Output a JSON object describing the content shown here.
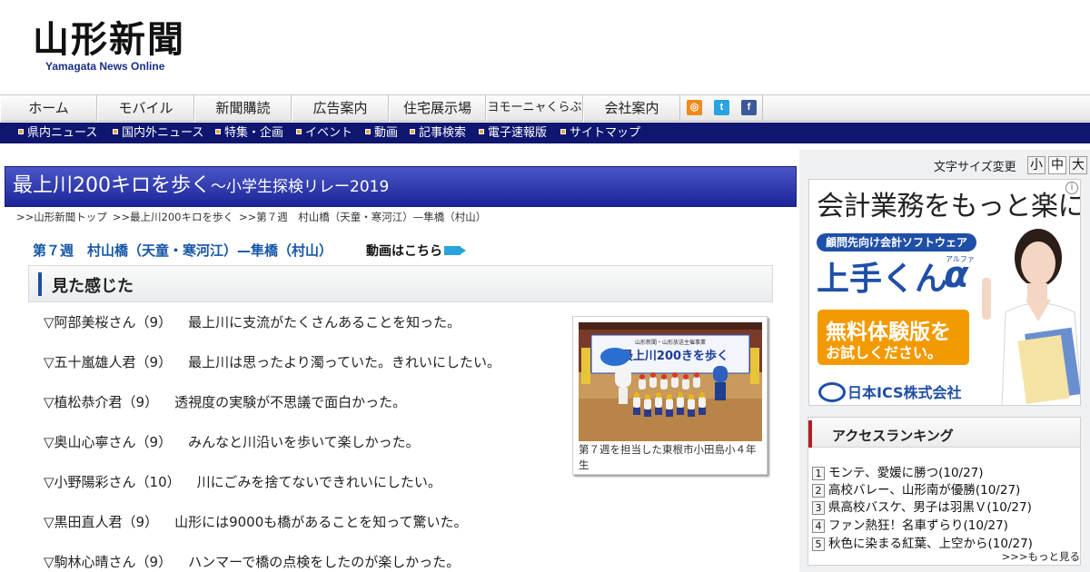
{
  "header": {
    "logo_text": "山形新聞",
    "logo_sub": "Yamagata News Online"
  },
  "main_nav": [
    "ホーム",
    "モバイル",
    "新聞購読",
    "広告案内",
    "住宅展示場",
    "ヨモーニャくらぶ",
    "会社案内"
  ],
  "social": [
    {
      "name": "rss-icon",
      "glyph": "◎",
      "color": "#f08a1c"
    },
    {
      "name": "twitter-icon",
      "glyph": "t",
      "color": "#2aa3e0"
    },
    {
      "name": "facebook-icon",
      "glyph": "f",
      "color": "#3b5998"
    }
  ],
  "sub_nav": [
    "県内ニュース",
    "国内外ニュース",
    "特集・企画",
    "イベント",
    "動画",
    "記事検索",
    "電子速報版",
    "サイトマップ"
  ],
  "banner": {
    "title": "最上川200キロを歩く",
    "subtitle": "～小学生探検リレー2019"
  },
  "breadcrumb": [
    ">>山形新聞トップ",
    ">>最上川200キロを歩く",
    ">>第７週　村山橋（天童・寒河江）—隼橋（村山）"
  ],
  "week_title": "第７週　村山橋（天童・寒河江）—隼橋（村山）",
  "video_link": "動画はこちら",
  "section_heading": "見た感じた",
  "quotes": [
    {
      "name": "▽阿部美桜さん（9）",
      "text": "最上川に支流がたくさんあることを知った。"
    },
    {
      "name": "▽五十嵐雄人君（9）",
      "text": "最上川は思ったより濁っていた。きれいにしたい。"
    },
    {
      "name": "▽植松恭介君（9）",
      "text": "透視度の実験が不思議で面白かった。"
    },
    {
      "name": "▽奥山心寧さん（9）",
      "text": "みんなと川沿いを歩いて楽しかった。"
    },
    {
      "name": "▽小野陽彩さん（10）",
      "text": "川にごみを捨てないできれいにしたい。"
    },
    {
      "name": "▽黒田直人君（9）",
      "text": "山形には9000も橋があることを知って驚いた。"
    },
    {
      "name": "▽駒林心晴さん（9）",
      "text": "ハンマーで橋の点検をしたのが楽しかった。"
    }
  ],
  "photo": {
    "banner_text": "最上川200きを歩く",
    "banner_small": "山形新聞・山形放送主催事業",
    "caption": "第７週を担当した東根市小田島小４年生"
  },
  "font_size": {
    "label": "文字サイズ変更",
    "options": [
      "小",
      "中",
      "大"
    ],
    "selected": "中"
  },
  "ad": {
    "headline": "会計業務をもっと楽に。",
    "tag": "顧問先向け会計ソフトウェア",
    "product": "上手くん",
    "product_alpha": "α",
    "product_ruby": "アルファ",
    "trial_line1": "無料体験版を",
    "trial_line2": "お試しください。",
    "company": "日本ICS株式会社",
    "info_glyph": "i"
  },
  "ranking": {
    "title": "アクセスランキング",
    "items": [
      {
        "num": "1",
        "text": "モンテ、愛媛に勝つ(10/27)"
      },
      {
        "num": "2",
        "text": "高校バレー、山形南が優勝(10/27)"
      },
      {
        "num": "3",
        "text": "県高校バスケ、男子は羽黒Ｖ(10/27)"
      },
      {
        "num": "4",
        "text": "ファン熱狂！名車ずらり(10/27)"
      },
      {
        "num": "5",
        "text": "秋色に染まる紅葉、上空から(10/27)"
      }
    ],
    "more": ">>>もっと見る"
  }
}
